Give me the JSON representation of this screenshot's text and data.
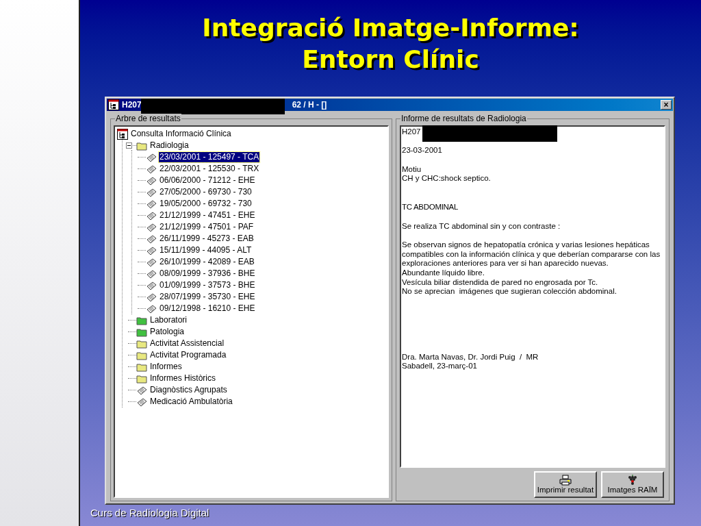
{
  "slide": {
    "title_lines": [
      "Integració Imatge-Informe:",
      "Entorn Clínic"
    ],
    "footer": "Curs de Radiologia Digital"
  },
  "window": {
    "title_start": "H207",
    "title_end": "62 / H - []",
    "close": "×"
  },
  "tree": {
    "label": "Arbre de resultats",
    "items": [
      {
        "label": "Consulta Informació Clínica",
        "kind": "app",
        "selected": false,
        "children": [
          {
            "label": "Radiologia",
            "kind": "folder",
            "color": "#e8e880",
            "selected": false,
            "expanded": true,
            "children": [
              {
                "label": "23/03/2001 - 125497 - TCA",
                "kind": "doc",
                "selected": true
              },
              {
                "label": "22/03/2001 - 125530 - TRX",
                "kind": "doc",
                "selected": false
              },
              {
                "label": "06/06/2000 - 71212 - EHE",
                "kind": "doc",
                "selected": false
              },
              {
                "label": "27/05/2000 - 69730 - 730",
                "kind": "doc",
                "selected": false
              },
              {
                "label": "19/05/2000 - 69732 - 730",
                "kind": "doc",
                "selected": false
              },
              {
                "label": "21/12/1999 - 47451 - EHE",
                "kind": "doc",
                "selected": false
              },
              {
                "label": "21/12/1999 - 47501 - PAF",
                "kind": "doc",
                "selected": false
              },
              {
                "label": "26/11/1999 - 45273 - EAB",
                "kind": "doc",
                "selected": false
              },
              {
                "label": "15/11/1999 - 44095 - ALT",
                "kind": "doc",
                "selected": false
              },
              {
                "label": "26/10/1999 - 42089 - EAB",
                "kind": "doc",
                "selected": false
              },
              {
                "label": "08/09/1999 - 37936 - BHE",
                "kind": "doc",
                "selected": false
              },
              {
                "label": "01/09/1999 - 37573 - BHE",
                "kind": "doc",
                "selected": false
              },
              {
                "label": "28/07/1999 - 35730 - EHE",
                "kind": "doc",
                "selected": false
              },
              {
                "label": "09/12/1998 - 16210 - EHE",
                "kind": "doc",
                "selected": false
              }
            ]
          },
          {
            "label": "Laboratori",
            "kind": "folder",
            "color": "#40c040",
            "selected": false
          },
          {
            "label": "Patologia",
            "kind": "folder",
            "color": "#40c040",
            "selected": false
          },
          {
            "label": "Activitat Assistencial",
            "kind": "folder",
            "color": "#e8e880",
            "selected": false
          },
          {
            "label": "Activitat Programada",
            "kind": "folder",
            "color": "#e8e880",
            "selected": false
          },
          {
            "label": "Informes",
            "kind": "folder",
            "color": "#e8e880",
            "selected": false
          },
          {
            "label": "Informes Històrics",
            "kind": "folder",
            "color": "#e8e880",
            "selected": false
          },
          {
            "label": "Diagnòstics Agrupats",
            "kind": "doc",
            "selected": false
          },
          {
            "label": "Medicació Ambulatòria",
            "kind": "doc",
            "selected": false
          }
        ]
      }
    ]
  },
  "report": {
    "label": "Informe de resultats de Radiologia",
    "blocks": [
      {
        "kind": "header",
        "lines": [
          "H207",
          "23-03-2001"
        ]
      },
      {
        "kind": "text",
        "lines": [
          "Motiu",
          "CH y CHC:shock septico."
        ]
      },
      {
        "kind": "heading",
        "lines": [
          "TC ABDOMINAL"
        ]
      },
      {
        "kind": "text",
        "lines": [
          "Se realiza TC abdominal sin y con contraste :"
        ]
      },
      {
        "kind": "text",
        "lines": [
          "Se observan signos de hepatopatía crónica y varias lesiones hepáticas",
          "compatibles con la información clínica y que deberían compararse con las",
          "exploraciones anteriores para ver si han aparecido nuevas.",
          "Abundante líquido libre.",
          "Vesícula biliar distendida de pared no engrosada por Tc.",
          "No se aprecian  imágenes que sugieran colección abdominal."
        ]
      },
      {
        "kind": "signature",
        "lines": [
          "Dra. Marta Navas, Dr. Jordi Puig  /  MR",
          "Sabadell, 23-març-01"
        ]
      }
    ]
  },
  "buttons": [
    {
      "label": "Imprimir resultat",
      "kind": "print"
    },
    {
      "label": "Imatges RAÏM",
      "kind": "images"
    }
  ]
}
